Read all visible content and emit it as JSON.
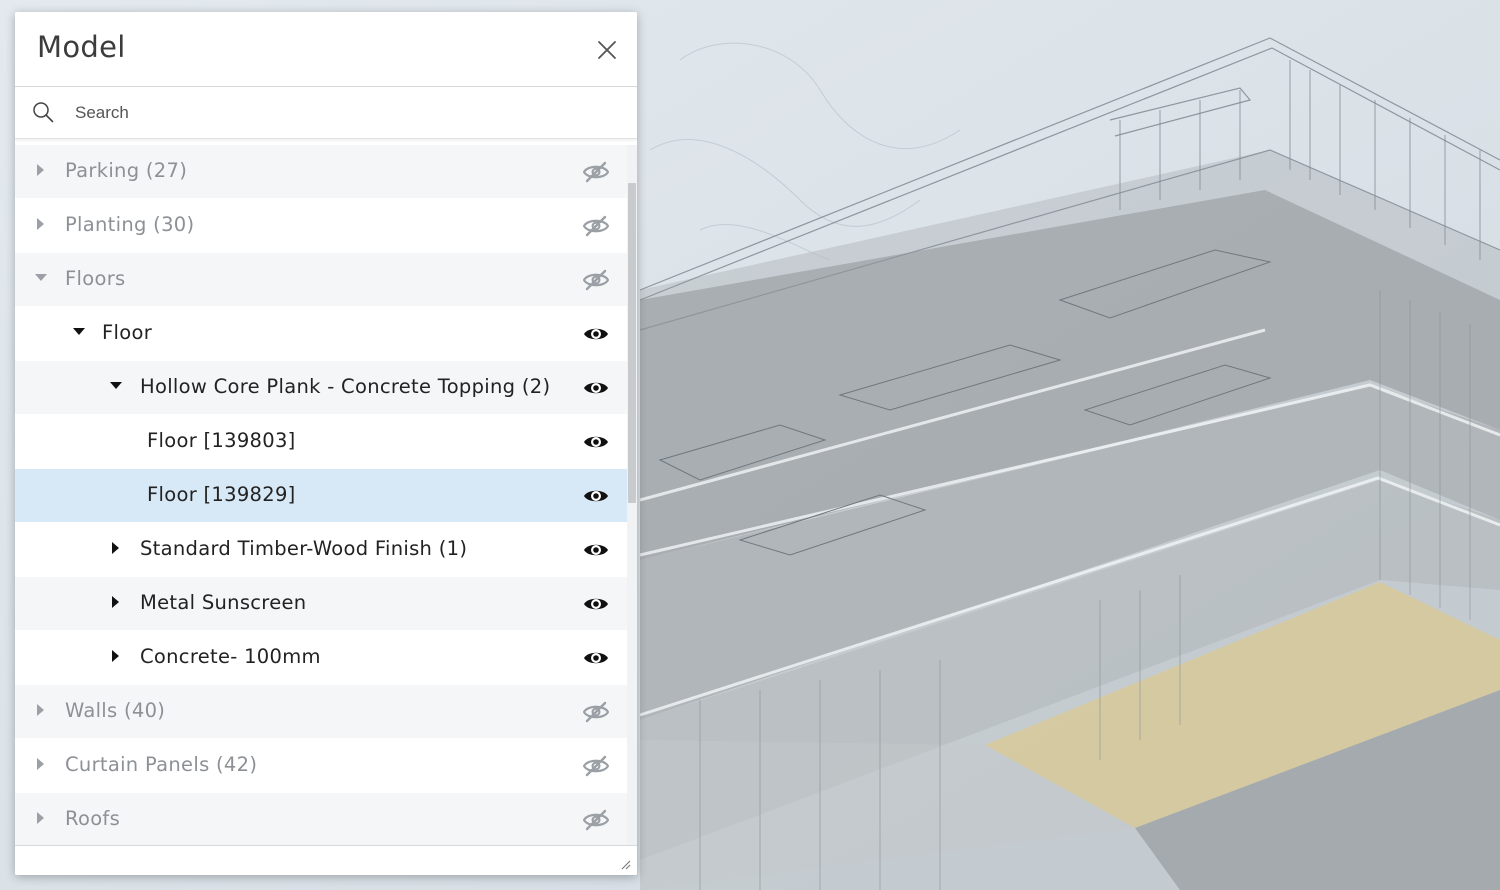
{
  "panel": {
    "title": "Model",
    "close_icon": "close-icon"
  },
  "search": {
    "placeholder": "Search",
    "value": ""
  },
  "tree": {
    "items": [
      {
        "label": "Parking (27)",
        "expanded": false,
        "visible": false,
        "level": 0
      },
      {
        "label": "Planting (30)",
        "expanded": false,
        "visible": false,
        "level": 0
      },
      {
        "label": "Floors",
        "expanded": true,
        "visible": false,
        "level": 0
      },
      {
        "label": "Floor",
        "expanded": true,
        "visible": true,
        "level": 1
      },
      {
        "label": "Hollow Core Plank - Concrete Topping (2)",
        "expanded": true,
        "visible": true,
        "level": 2
      },
      {
        "label": "Floor [139803]",
        "visible": true,
        "level": 3
      },
      {
        "label": "Floor [139829]",
        "visible": true,
        "level": 3,
        "selected": true
      },
      {
        "label": "Standard Timber-Wood Finish (1)",
        "expanded": false,
        "visible": true,
        "level": 2
      },
      {
        "label": "Metal Sunscreen",
        "expanded": false,
        "visible": true,
        "level": 2
      },
      {
        "label": "Concrete- 100mm",
        "expanded": false,
        "visible": true,
        "level": 2
      },
      {
        "label": "Walls (40)",
        "expanded": false,
        "visible": false,
        "level": 0
      },
      {
        "label": "Curtain Panels (42)",
        "expanded": false,
        "visible": false,
        "level": 0
      },
      {
        "label": "Roofs",
        "expanded": false,
        "visible": false,
        "level": 0
      }
    ]
  },
  "colors": {
    "selected_row": "#d7e8f6",
    "highlighted_floor": "#d8c99a",
    "viewport_background": "#dfe5ea"
  }
}
